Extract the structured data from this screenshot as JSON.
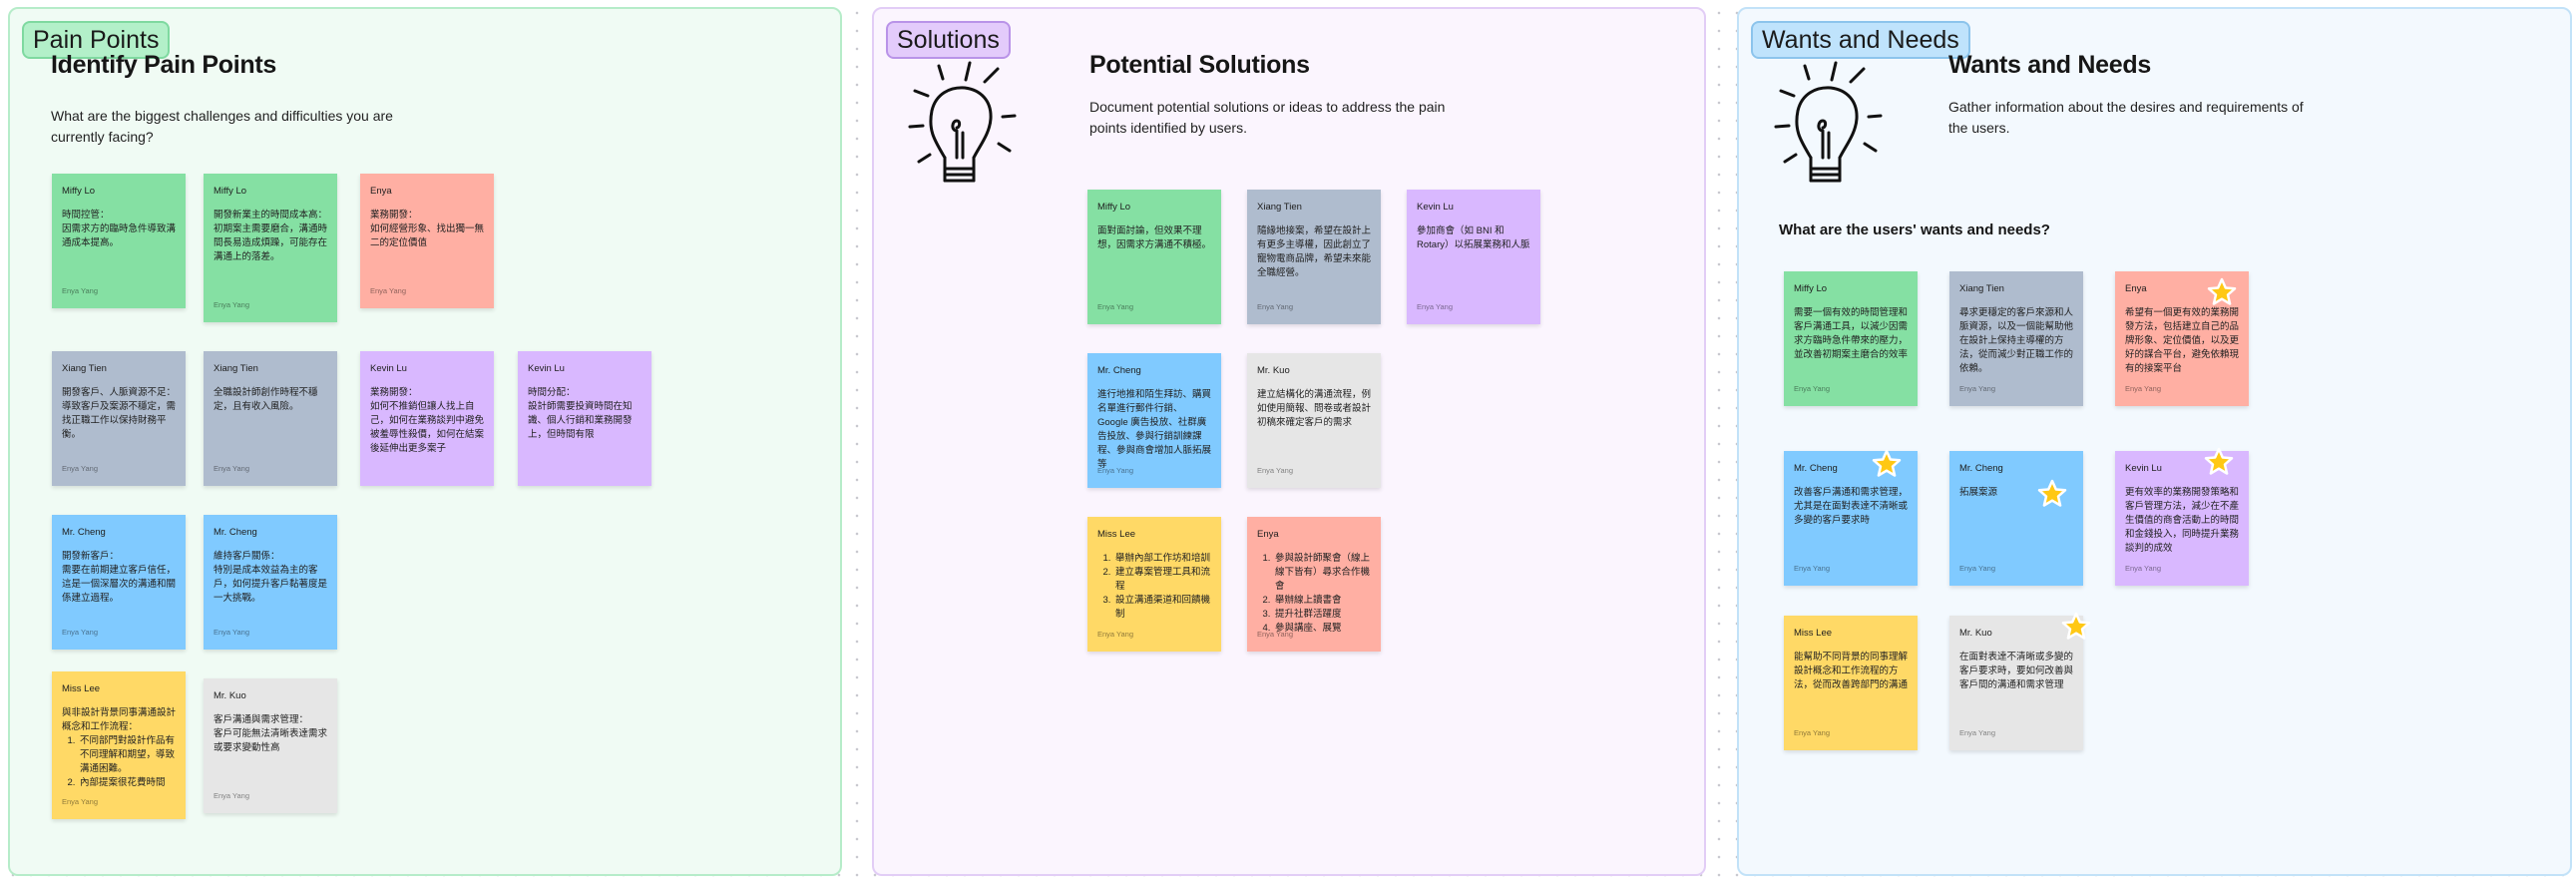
{
  "canvas": {
    "frames": [
      {
        "id": "pain",
        "label": "Pain Points",
        "title": "Identify Pain Points",
        "description": "What are the biggest challenges and difficulties you are currently facing?",
        "notes": [
          {
            "author": "Miffy Lo",
            "body": "時間控管：\n因需求方的臨時急件導致溝通成本提高。",
            "footer": "Enya Yang",
            "color": "green"
          },
          {
            "author": "Miffy Lo",
            "body": "開發新業主的時間成本高：初期案主需要磨合，溝通時間長易造成煩躁，可能存在溝通上的落差。",
            "footer": "Enya Yang",
            "color": "green"
          },
          {
            "author": "Enya",
            "body": "業務開發：\n如何經營形象、找出獨一無二的定位價值",
            "footer": "Enya Yang",
            "color": "salmon"
          },
          {
            "author": "Xiang Tien",
            "body": "開發客戶、人脈資源不足：導致客戶及案源不穩定，需找正職工作以保持財務平衡。",
            "footer": "Enya Yang",
            "color": "slate"
          },
          {
            "author": "Xiang Tien",
            "body": "全職設計師創作時程不穩定，且有收入風險。",
            "footer": "Enya Yang",
            "color": "slate"
          },
          {
            "author": "Kevin Lu",
            "body": "業務開發：\n如何不推銷但讓人找上自己，如何在業務談判中避免被羞辱性殺價，如何在結案後延伸出更多案子",
            "footer": "",
            "color": "purple"
          },
          {
            "author": "Kevin Lu",
            "body": "時間分配：\n設計師需要投資時間在知識、個人行銷和業務開發上，但時間有限",
            "footer": "",
            "color": "purple"
          },
          {
            "author": "Mr. Cheng",
            "body": "開發新客戶：\n需要在前期建立客戶信任，這是一個深層次的溝通和關係建立過程。",
            "footer": "Enya Yang",
            "color": "blue"
          },
          {
            "author": "Mr. Cheng",
            "body": "維持客戶關係：\n特別是成本效益為主的客戶，如何提升客戶黏著度是一大挑戰。",
            "footer": "Enya Yang",
            "color": "blue"
          },
          {
            "author": "Miss Lee",
            "body": "與非設計背景同事溝通設計概念和工作流程：",
            "list": [
              "不同部門對設計作品有不同理解和期望，導致溝通困難。",
              "內部提案很花費時間"
            ],
            "footer": "Enya Yang",
            "color": "yellow"
          },
          {
            "author": "Mr. Kuo",
            "body": "客戶溝通與需求管理：\n客戶可能無法清晰表達需求或要求變動性高",
            "footer": "Enya Yang",
            "color": "gray"
          }
        ]
      },
      {
        "id": "sol",
        "label": "Solutions",
        "title": "Potential Solutions",
        "description": "Document potential solutions or ideas to address the pain points identified by users.",
        "notes": [
          {
            "author": "Miffy Lo",
            "body": "面對面討論，但效果不理想，因需求方溝通不積極。",
            "footer": "Enya Yang",
            "color": "green"
          },
          {
            "author": "Xiang Tien",
            "body": "隨緣地接案，希望在設計上有更多主導權，因此創立了寵物電商品牌，希望未來能全職經營。",
            "footer": "Enya Yang",
            "color": "slate"
          },
          {
            "author": "Kevin Lu",
            "body": "參加商會（如 BNI 和 Rotary）以拓展業務和人脈",
            "footer": "Enya Yang",
            "color": "purple"
          },
          {
            "author": "Mr. Cheng",
            "body": "進行地推和陌生拜訪、購買名單進行郵件行銷、Google 廣告投放、社群廣告投放、參與行銷訓練課程、參與商會增加人脈拓展等",
            "footer": "Enya Yang",
            "color": "blue"
          },
          {
            "author": "Mr. Kuo",
            "body": "建立結構化的溝通流程，例如使用簡報、問卷或者設計初稿來確定客戶的需求",
            "footer": "Enya Yang",
            "color": "gray"
          },
          {
            "author": "Miss Lee",
            "body": "",
            "list": [
              "舉辦內部工作坊和培訓",
              "建立專案管理工具和流程",
              "設立溝通渠道和回饋機制"
            ],
            "footer": "Enya Yang",
            "color": "yellow"
          },
          {
            "author": "Enya",
            "body": "",
            "list": [
              "參與設計師聚會（線上線下皆有）尋求合作機會",
              "舉辦線上讀書會",
              "提升社群活躍度",
              "參與講座、展覽"
            ],
            "footer": "Enya Yang",
            "color": "salmon"
          }
        ]
      },
      {
        "id": "want",
        "label": "Wants and Needs",
        "title": "Wants and Needs",
        "description": "Gather information about the desires and requirements of the users.",
        "question": "What are the users' wants and needs?",
        "notes": [
          {
            "author": "Miffy Lo",
            "body": "需要一個有效的時間管理和客戶溝通工具，以減少因需求方臨時急件帶來的壓力，並改善初期案主磨合的效率",
            "footer": "Enya Yang",
            "color": "green",
            "starred": false
          },
          {
            "author": "Xiang Tien",
            "body": "尋求更穩定的客戶來源和人脈資源，以及一個能幫助他在設計上保持主導權的方法，從而減少對正職工作的依賴。",
            "footer": "Enya Yang",
            "color": "slate",
            "starred": false
          },
          {
            "author": "Enya",
            "body": "希望有一個更有效的業務開發方法，包括建立自己的品牌形象、定位價值，以及更好的謀合平台，避免依賴現有的接案平台",
            "footer": "Enya Yang",
            "color": "salmon",
            "starred": true
          },
          {
            "author": "Mr. Cheng",
            "body": "改善客戶溝通和需求管理，尤其是在面對表達不清晰或多變的客戶要求時",
            "footer": "Enya Yang",
            "color": "blue",
            "starred": true
          },
          {
            "author": "Mr. Cheng",
            "body": "拓展案源",
            "footer": "Enya Yang",
            "color": "blue",
            "starred": true
          },
          {
            "author": "Kevin Lu",
            "body": "更有效率的業務開發策略和客戶管理方法，減少在不產生價值的商會活動上的時間和金錢投入，同時提升業務談判的成效",
            "footer": "Enya Yang",
            "color": "purple",
            "starred": true
          },
          {
            "author": "Miss Lee",
            "body": "能幫助不同背景的同事理解設計概念和工作流程的方法，從而改善跨部門的溝通",
            "footer": "Enya Yang",
            "color": "yellow",
            "starred": false
          },
          {
            "author": "Mr. Kuo",
            "body": "在面對表達不清晰或多變的客戶要求時，要如何改善與客戶間的溝通和需求管理",
            "footer": "Enya Yang",
            "color": "gray",
            "starred": true
          }
        ]
      }
    ]
  },
  "icons": {
    "lightbulb": "lightbulb-icon",
    "star": "star-icon"
  }
}
